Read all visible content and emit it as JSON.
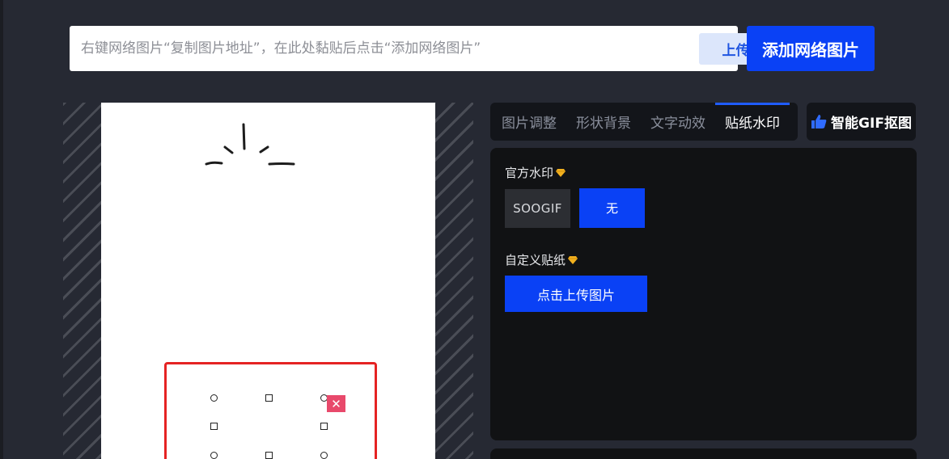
{
  "search": {
    "placeholder": "右键网络图片“复制图片地址”，在此处黏贴后点击“添加网络图片”",
    "value": "",
    "upload_label": "上传素材",
    "add_network_label": "添加网络图片"
  },
  "tabs": [
    {
      "label": "图片调整",
      "active": false
    },
    {
      "label": "形状背景",
      "active": false
    },
    {
      "label": "文字动效",
      "active": false
    },
    {
      "label": "贴纸水印",
      "active": true
    }
  ],
  "gif_tab": {
    "icon": "thumbs-up-icon",
    "label": "智能GIF抠图"
  },
  "watermark": {
    "title": "官方水印",
    "title_icon": "diamond-icon",
    "options": [
      "SOOGIF",
      "无"
    ],
    "selected": "无"
  },
  "sticker": {
    "title": "自定义贴纸",
    "title_icon": "diamond-icon",
    "upload_label": "点击上传图片"
  },
  "colors": {
    "background": "#262933",
    "accent": "#0a41f5",
    "panel": "#111214",
    "selection": "#e52323",
    "delete": "#e8496b",
    "diamond": "#f2b01e"
  }
}
